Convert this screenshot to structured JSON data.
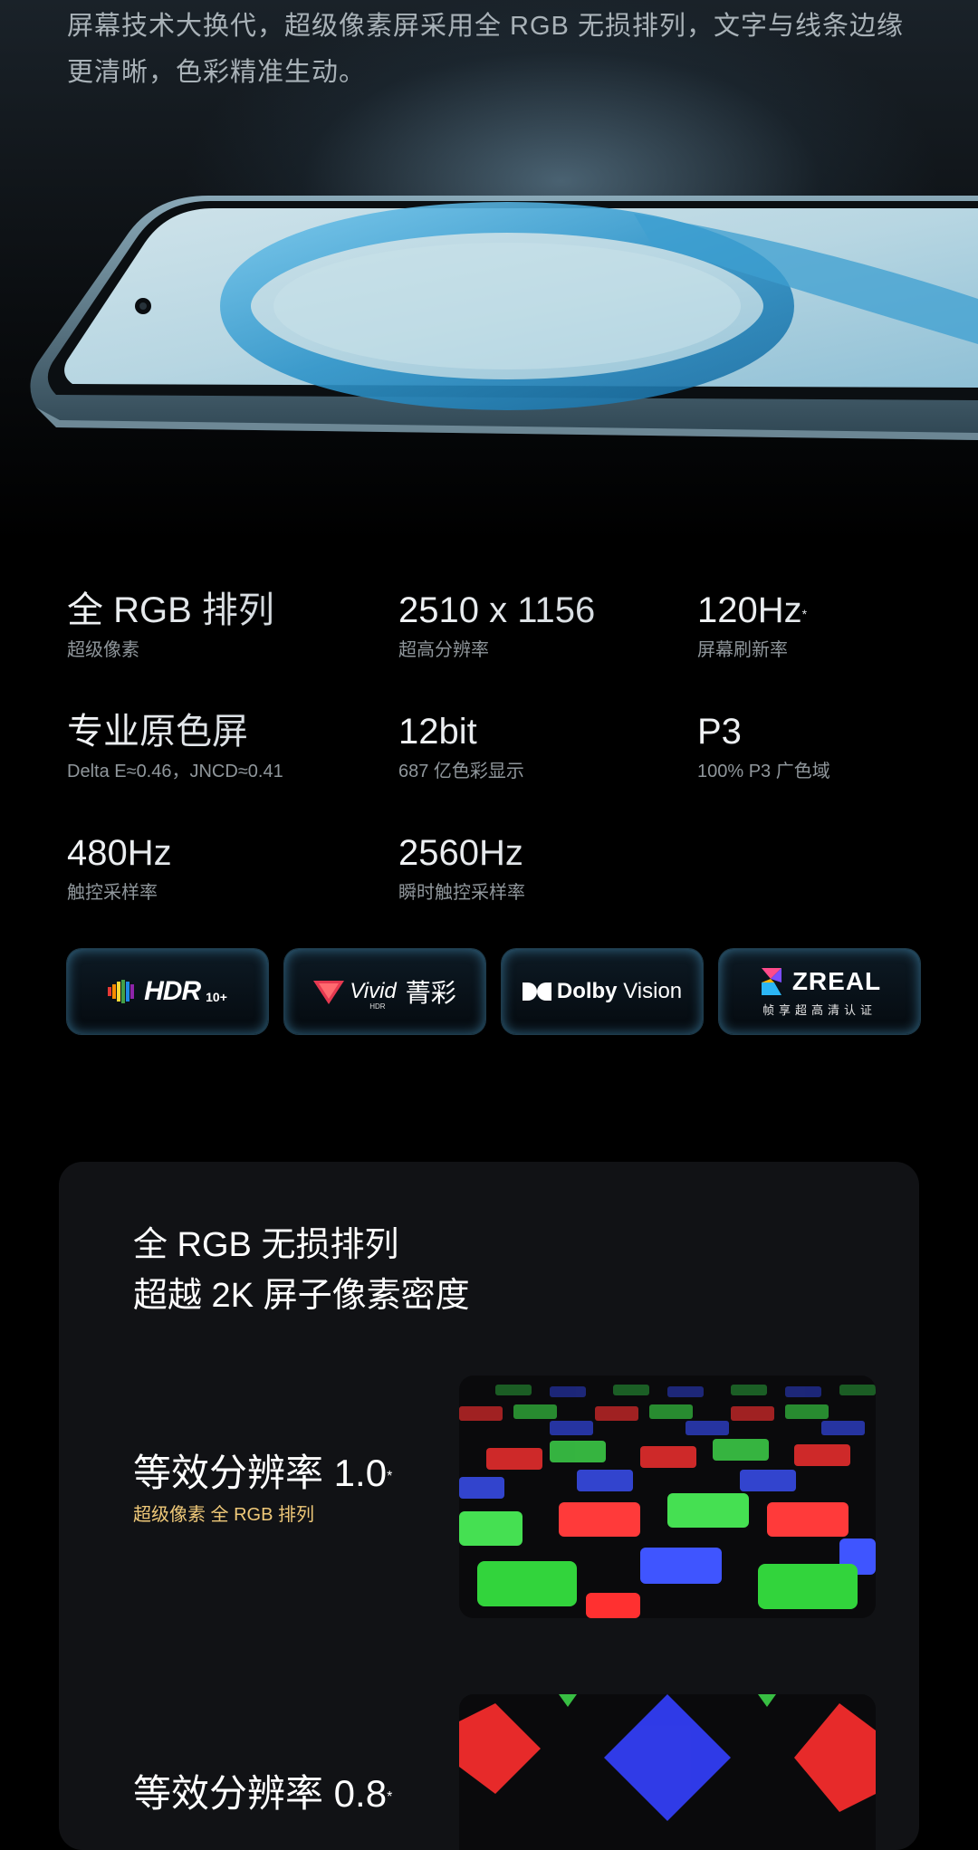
{
  "intro_text": "屏幕技术大换代，超级像素屏采用全 RGB 无损排列，文字与线条边缘更清晰，色彩精准生动。",
  "specs": [
    {
      "value": "全 RGB 排列",
      "asterisk": "",
      "label": "超级像素"
    },
    {
      "value": "2510 x 1156",
      "asterisk": "",
      "label": "超高分辨率"
    },
    {
      "value": "120Hz",
      "asterisk": "*",
      "label": "屏幕刷新率"
    },
    {
      "value": "专业原色屏",
      "asterisk": "",
      "label": "Delta E≈0.46，JNCD≈0.41"
    },
    {
      "value": "12bit",
      "asterisk": "",
      "label": "687 亿色彩显示"
    },
    {
      "value": "P3",
      "asterisk": "",
      "label": "100% P3 广色域"
    },
    {
      "value": "480Hz",
      "asterisk": "",
      "label": "触控采样率"
    },
    {
      "value": "2560Hz",
      "asterisk": "",
      "label": "瞬时触控采样率"
    }
  ],
  "badges": {
    "hdr": {
      "main": "HDR",
      "sub": "10+"
    },
    "vivid": {
      "main": "Vivid",
      "hdr": "HDR",
      "cn": "菁彩"
    },
    "dolby": {
      "bold": "Dolby",
      "light": " Vision"
    },
    "zreal": {
      "main": "ZREAL",
      "sub": "帧享超高清认证"
    }
  },
  "card": {
    "title_line1": "全 RGB 无损排列",
    "title_line2": "超越 2K 屏子像素密度",
    "items": [
      {
        "title": "等效分辨率 1.0",
        "asterisk": "*",
        "subtitle": "超级像素 全 RGB 排列"
      },
      {
        "title": "等效分辨率 0.8",
        "asterisk": "*",
        "subtitle": ""
      }
    ]
  },
  "colors": {
    "accent_gold": "#f0c979",
    "badge_glow": "#58b4e6",
    "card_bg": "#111215"
  }
}
